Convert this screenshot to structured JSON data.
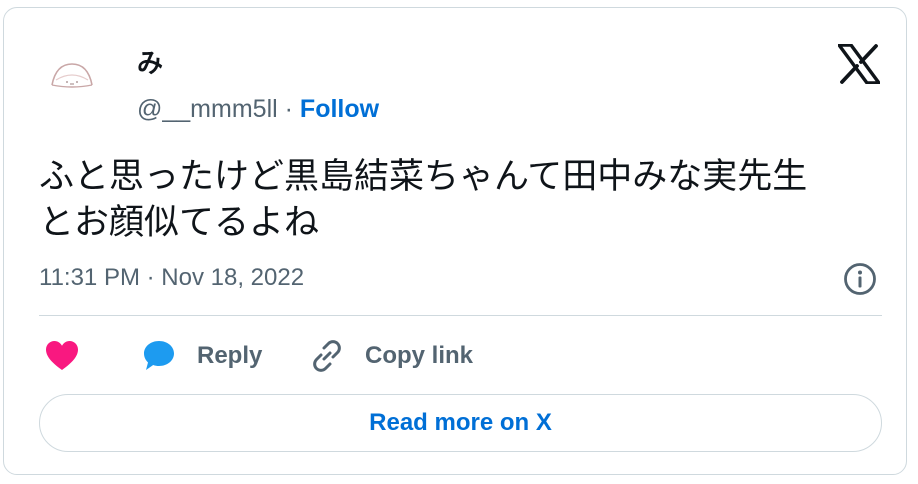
{
  "author": {
    "display_name": "み",
    "handle": "@__mmm5ll",
    "separator": "·",
    "follow_label": "Follow"
  },
  "tweet": {
    "text": "ふと思ったけど黒島結菜ちゃんて田中みな実先生\nとお顔似てるよね",
    "timestamp": "11:31 PM · Nov 18, 2022"
  },
  "actions": {
    "like_icon": "heart-icon",
    "reply_icon": "speech-bubble-icon",
    "reply_label": "Reply",
    "copy_icon": "link-icon",
    "copy_label": "Copy link"
  },
  "read_more_label": "Read more on X",
  "colors": {
    "link_blue": "#006fd6",
    "like_pink": "#f91880",
    "reply_blue": "#1d9bf0",
    "muted_text": "#536471",
    "border": "#cfd9de",
    "text": "#0f1419"
  }
}
